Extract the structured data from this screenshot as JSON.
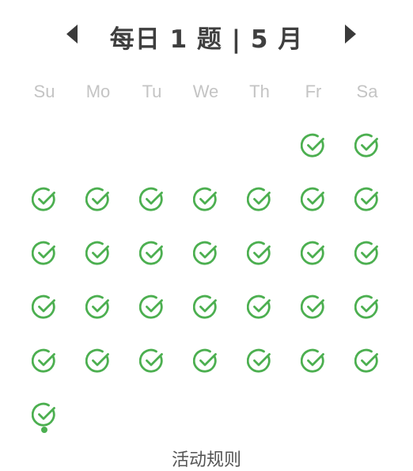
{
  "header": {
    "title": "每日 1 题 | 5 月",
    "prev_icon": "triangle-left-icon",
    "next_icon": "triangle-right-icon"
  },
  "calendar": {
    "weekdays": [
      "Su",
      "Mo",
      "Tu",
      "We",
      "Th",
      "Fr",
      "Sa"
    ],
    "first_weekday_index": 5,
    "days_completed": 31,
    "today": 31,
    "status_icon": "check-circle-icon",
    "accent_color": "#4caf50"
  },
  "footer": {
    "rules_label": "活动规则"
  }
}
